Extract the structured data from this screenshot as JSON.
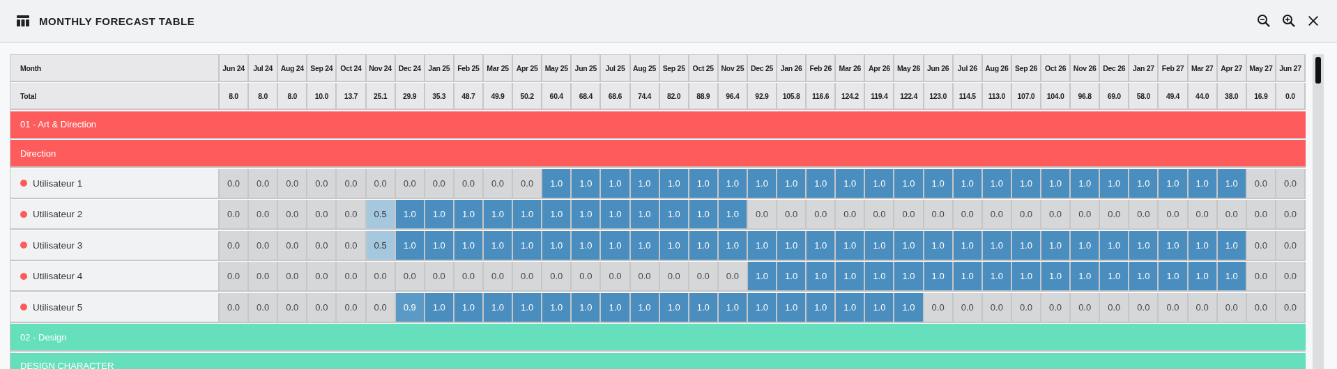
{
  "window": {
    "title": "MONTHLY FORECAST TABLE"
  },
  "toolbar": [
    {
      "kind": "zoom-out"
    },
    {
      "kind": "zoom-in"
    },
    {
      "kind": "close"
    }
  ],
  "table": {
    "header_label": "Month",
    "months": [
      "Jun 24",
      "Jul 24",
      "Aug 24",
      "Sep 24",
      "Oct 24",
      "Nov 24",
      "Dec 24",
      "Jan 25",
      "Feb 25",
      "Mar 25",
      "Apr 25",
      "May 25",
      "Jun 25",
      "Jul 25",
      "Aug 25",
      "Sep 25",
      "Oct 25",
      "Nov 25",
      "Dec 25",
      "Jan 26",
      "Feb 26",
      "Mar 26",
      "Apr 26",
      "May 26",
      "Jun 26",
      "Jul 26",
      "Aug 26",
      "Sep 26",
      "Oct 26",
      "Nov 26",
      "Dec 26",
      "Jan 27",
      "Feb 27",
      "Mar 27",
      "Apr 27",
      "May 27",
      "Jun 27"
    ],
    "total_label": "Total",
    "totals": [
      "8.0",
      "8.0",
      "8.0",
      "10.0",
      "13.7",
      "25.1",
      "29.9",
      "35.3",
      "48.7",
      "49.9",
      "50.2",
      "60.4",
      "68.4",
      "68.6",
      "74.4",
      "82.0",
      "88.9",
      "96.4",
      "92.9",
      "105.8",
      "116.6",
      "124.2",
      "119.4",
      "122.4",
      "123.0",
      "114.5",
      "113.0",
      "107.0",
      "104.0",
      "96.8",
      "69.0",
      "58.0",
      "49.4",
      "44.0",
      "38.0",
      "16.9",
      "0.0"
    ],
    "rows": [
      {
        "kind": "group",
        "label": "01 - Art & Direction",
        "color": "#fe5c5c"
      },
      {
        "kind": "group",
        "label": "Direction",
        "color": "#fe5c5c"
      },
      {
        "kind": "user",
        "name": "Utilisateur 1",
        "color": "#fe5c5c",
        "cells": [
          "0.0",
          "0.0",
          "0.0",
          "0.0",
          "0.0",
          "0.0",
          "0.0",
          "0.0",
          "0.0",
          "0.0",
          "0.0",
          "1.0",
          "1.0",
          "1.0",
          "1.0",
          "1.0",
          "1.0",
          "1.0",
          "1.0",
          "1.0",
          "1.0",
          "1.0",
          "1.0",
          "1.0",
          "1.0",
          "1.0",
          "1.0",
          "1.0",
          "1.0",
          "1.0",
          "1.0",
          "1.0",
          "1.0",
          "1.0",
          "1.0",
          "0.0",
          "0.0"
        ]
      },
      {
        "kind": "user",
        "name": "Utilisateur 2",
        "color": "#fe5c5c",
        "cells": [
          "0.0",
          "0.0",
          "0.0",
          "0.0",
          "0.0",
          "0.5",
          "1.0",
          "1.0",
          "1.0",
          "1.0",
          "1.0",
          "1.0",
          "1.0",
          "1.0",
          "1.0",
          "1.0",
          "1.0",
          "1.0",
          "0.0",
          "0.0",
          "0.0",
          "0.0",
          "0.0",
          "0.0",
          "0.0",
          "0.0",
          "0.0",
          "0.0",
          "0.0",
          "0.0",
          "0.0",
          "0.0",
          "0.0",
          "0.0",
          "0.0",
          "0.0",
          "0.0"
        ]
      },
      {
        "kind": "user",
        "name": "Utilisateur 3",
        "color": "#fe5c5c",
        "cells": [
          "0.0",
          "0.0",
          "0.0",
          "0.0",
          "0.0",
          "0.5",
          "1.0",
          "1.0",
          "1.0",
          "1.0",
          "1.0",
          "1.0",
          "1.0",
          "1.0",
          "1.0",
          "1.0",
          "1.0",
          "1.0",
          "1.0",
          "1.0",
          "1.0",
          "1.0",
          "1.0",
          "1.0",
          "1.0",
          "1.0",
          "1.0",
          "1.0",
          "1.0",
          "1.0",
          "1.0",
          "1.0",
          "1.0",
          "1.0",
          "1.0",
          "0.0",
          "0.0"
        ]
      },
      {
        "kind": "user",
        "name": "Utilisateur 4",
        "color": "#fe5c5c",
        "cells": [
          "0.0",
          "0.0",
          "0.0",
          "0.0",
          "0.0",
          "0.0",
          "0.0",
          "0.0",
          "0.0",
          "0.0",
          "0.0",
          "0.0",
          "0.0",
          "0.0",
          "0.0",
          "0.0",
          "0.0",
          "0.0",
          "1.0",
          "1.0",
          "1.0",
          "1.0",
          "1.0",
          "1.0",
          "1.0",
          "1.0",
          "1.0",
          "1.0",
          "1.0",
          "1.0",
          "1.0",
          "1.0",
          "1.0",
          "1.0",
          "1.0",
          "0.0",
          "0.0"
        ]
      },
      {
        "kind": "user",
        "name": "Utilisateur 5",
        "color": "#fe5c5c",
        "cells": [
          "0.0",
          "0.0",
          "0.0",
          "0.0",
          "0.0",
          "0.0",
          "0.9",
          "1.0",
          "1.0",
          "1.0",
          "1.0",
          "1.0",
          "1.0",
          "1.0",
          "1.0",
          "1.0",
          "1.0",
          "1.0",
          "1.0",
          "1.0",
          "1.0",
          "1.0",
          "1.0",
          "1.0",
          "0.0",
          "0.0",
          "0.0",
          "0.0",
          "0.0",
          "0.0",
          "0.0",
          "0.0",
          "0.0",
          "0.0",
          "0.0",
          "0.0",
          "0.0"
        ]
      },
      {
        "kind": "group",
        "label": "02 - Design",
        "color": "#66e0bc"
      },
      {
        "kind": "group",
        "label": "DESIGN CHARACTER",
        "color": "#66e0bc"
      }
    ]
  }
}
